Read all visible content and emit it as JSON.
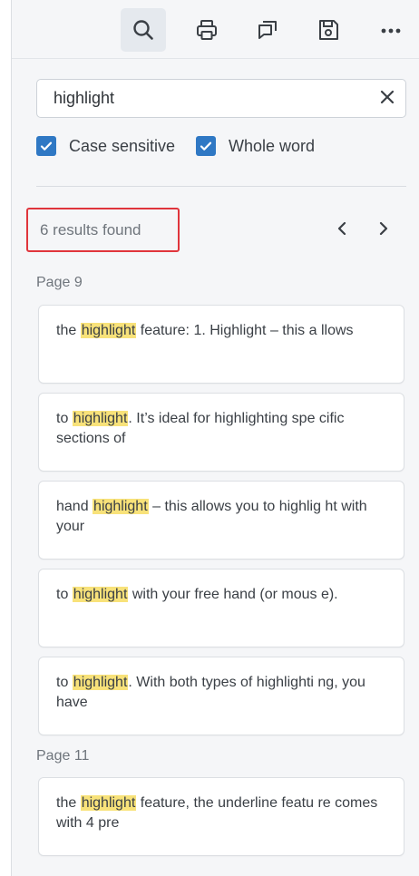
{
  "toolbar": {
    "buttons": [
      {
        "icon": "search-icon",
        "active": true
      },
      {
        "icon": "printer-icon",
        "active": false
      },
      {
        "icon": "comments-icon",
        "active": false
      },
      {
        "icon": "save-icon",
        "active": false
      },
      {
        "icon": "more-icon",
        "active": false
      }
    ]
  },
  "search": {
    "value": "highlight",
    "placeholder": ""
  },
  "options": {
    "case_sensitive": {
      "label": "Case sensitive",
      "checked": true
    },
    "whole_word": {
      "label": "Whole word",
      "checked": true
    }
  },
  "results": {
    "count_text": "6 results found",
    "groups": [
      {
        "page_label": "Page 9",
        "items": [
          {
            "before": "the ",
            "match": "highlight",
            "after": " feature: 1. Highlight – this a llows"
          },
          {
            "before": "to ",
            "match": "highlight",
            "after": ". It’s ideal for highlighting spe cific sections of"
          },
          {
            "before": "hand ",
            "match": "highlight",
            "after": " – this allows you to highlig ht with your"
          },
          {
            "before": "to ",
            "match": "highlight",
            "after": " with your free hand (or mous e)."
          },
          {
            "before": "to ",
            "match": "highlight",
            "after": ". With both types of highlighti ng, you have"
          }
        ]
      },
      {
        "page_label": "Page 11",
        "items": [
          {
            "before": "the ",
            "match": "highlight",
            "after": " feature, the underline featu re comes with 4 pre"
          }
        ]
      }
    ]
  },
  "colors": {
    "accent": "#2f78c4",
    "highlight": "#f8e27a",
    "count_border": "#e0353c"
  }
}
